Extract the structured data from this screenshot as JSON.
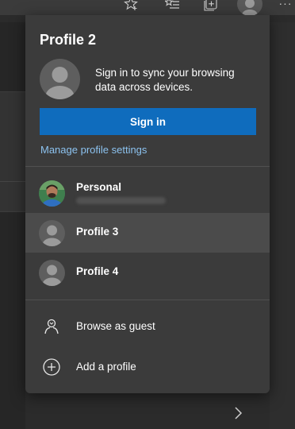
{
  "toolbar": {
    "icons": [
      "star-icon",
      "favorites-icon",
      "collections-icon",
      "profile-avatar",
      "more-icon"
    ],
    "more_label": "···"
  },
  "flyout": {
    "title": "Profile 2",
    "sync_message": "Sign in to sync your browsing data across devices.",
    "sign_in_label": "Sign in",
    "manage_label": "Manage profile settings",
    "profiles": [
      {
        "label": "Personal",
        "selected": false
      },
      {
        "label": "Profile 3",
        "selected": true
      },
      {
        "label": "Profile 4",
        "selected": false
      }
    ],
    "actions": [
      {
        "label": "Browse as guest",
        "icon": "guest-icon"
      },
      {
        "label": "Add a profile",
        "icon": "add-circle-icon"
      }
    ]
  },
  "colors": {
    "accent": "#0f6cbd",
    "link": "#8cc2ef",
    "flyout_bg": "#3b3b3b",
    "selected_row": "#4b4b4b"
  }
}
